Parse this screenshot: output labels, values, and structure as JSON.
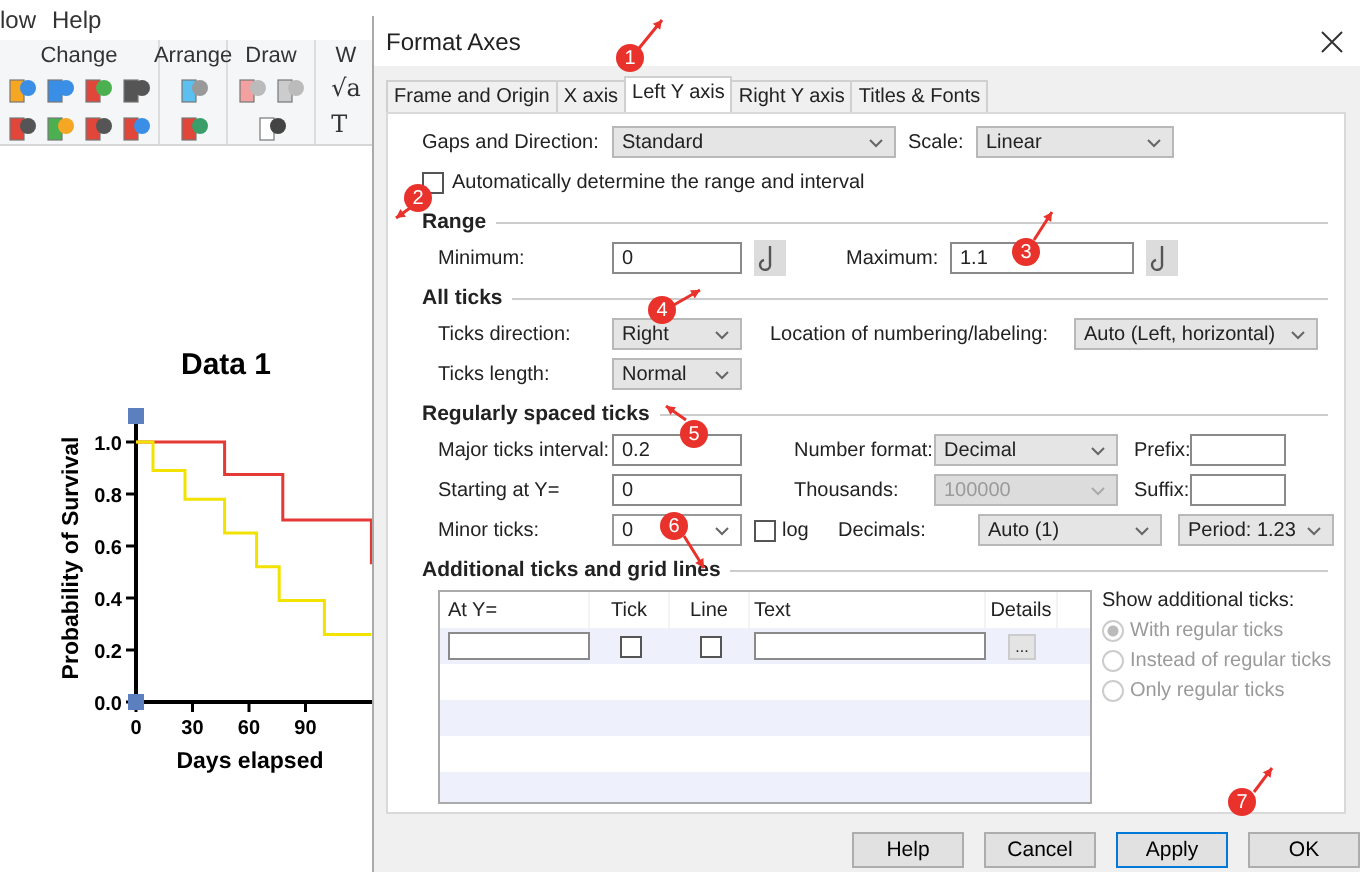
{
  "app": {
    "menu": [
      "low",
      "Help"
    ],
    "ribbon_groups": [
      {
        "label": "Change"
      },
      {
        "label": "Arrange"
      },
      {
        "label": "Draw"
      },
      {
        "label": "W",
        "glyphs": [
          "√a",
          "T"
        ]
      }
    ],
    "graph": {
      "chart_data": {
        "type": "line",
        "title": "Data 1",
        "xlabel": "Days elapsed",
        "ylabel": "Probability of Survival",
        "xlim": [
          0,
          125
        ],
        "ylim": [
          0,
          1.1
        ],
        "xticks": [
          0,
          30,
          60,
          90
        ],
        "yticks": [
          {
            "value": 0,
            "label": "0.0"
          },
          {
            "value": 0.2,
            "label": "0.2"
          },
          {
            "value": 0.4,
            "label": "0.4"
          },
          {
            "value": 0.6,
            "label": "0.6"
          },
          {
            "value": 0.8,
            "label": "0.8"
          },
          {
            "value": 1,
            "label": "1.0"
          }
        ],
        "series": [
          {
            "color": "#e53935",
            "x": [
              0,
              47,
              47,
              78,
              78,
              125,
              125
            ],
            "values": [
              1,
              1,
              0.875,
              0.875,
              0.7,
              0.7,
              0.53
            ]
          },
          {
            "color": "#f2e200",
            "x": [
              0,
              9,
              9,
              26,
              26,
              47,
              47,
              64,
              64,
              76,
              76,
              100,
              100,
              125
            ],
            "values": [
              1,
              1,
              0.89,
              0.89,
              0.78,
              0.78,
              0.65,
              0.65,
              0.52,
              0.52,
              0.39,
              0.39,
              0.26,
              0.26
            ]
          }
        ]
      }
    }
  },
  "dialog": {
    "title": "Format Axes",
    "tabs": [
      {
        "label": "Frame and Origin",
        "selected": false
      },
      {
        "label": "X axis",
        "selected": false
      },
      {
        "label": "Left Y axis",
        "selected": true
      },
      {
        "label": "Right Y axis",
        "selected": false
      },
      {
        "label": "Titles & Fonts",
        "selected": false
      }
    ],
    "gaps_direction": {
      "label": "Gaps and Direction:",
      "value": "Standard"
    },
    "scale": {
      "label": "Scale:",
      "value": "Linear"
    },
    "auto_range": {
      "label": "Automatically determine the range and interval",
      "checked": false
    },
    "range": {
      "title": "Range",
      "minimum": {
        "label": "Minimum:",
        "value": "0"
      },
      "maximum": {
        "label": "Maximum:",
        "value": "1.1"
      }
    },
    "all_ticks": {
      "title": "All ticks",
      "direction": {
        "label": "Ticks direction:",
        "value": "Right"
      },
      "location": {
        "label": "Location of numbering/labeling:",
        "value": "Auto (Left, horizontal)"
      },
      "length": {
        "label": "Ticks length:",
        "value": "Normal"
      }
    },
    "regular_ticks": {
      "title": "Regularly spaced ticks",
      "major_interval": {
        "label": "Major ticks interval:",
        "value": "0.2"
      },
      "starting_at": {
        "label": "Starting at Y=",
        "value": "0"
      },
      "minor_ticks": {
        "label": "Minor ticks:",
        "value": "0"
      },
      "log": {
        "label": "log",
        "checked": false
      },
      "number_format": {
        "label": "Number format:",
        "value": "Decimal"
      },
      "thousands": {
        "label": "Thousands:",
        "value": "100000",
        "disabled": true
      },
      "decimals": {
        "label": "Decimals:",
        "value": "Auto (1)"
      },
      "period": {
        "value": "Period: 1.23"
      },
      "prefix": {
        "label": "Prefix:"
      },
      "suffix": {
        "label": "Suffix:"
      }
    },
    "additional": {
      "title": "Additional ticks and grid lines",
      "columns": [
        "At Y=",
        "Tick",
        "Line",
        "Text",
        "Details"
      ],
      "rows": [
        {
          "tick": false,
          "line": false,
          "details": "..."
        }
      ],
      "show_label": "Show additional ticks:",
      "options_disabled": true,
      "options": [
        {
          "label": "With regular ticks",
          "selected": true
        },
        {
          "label": "Instead of regular ticks",
          "selected": false
        },
        {
          "label": "Only regular ticks",
          "selected": false
        }
      ]
    },
    "buttons": [
      {
        "label": "Help",
        "default": false
      },
      {
        "label": "Cancel",
        "default": false
      },
      {
        "label": "Apply",
        "default": true
      },
      {
        "label": "OK",
        "default": false
      }
    ]
  },
  "callouts": [
    {
      "number": "1"
    },
    {
      "number": "2"
    },
    {
      "number": "3"
    },
    {
      "number": "4"
    },
    {
      "number": "5"
    },
    {
      "number": "6"
    },
    {
      "number": "7"
    }
  ]
}
